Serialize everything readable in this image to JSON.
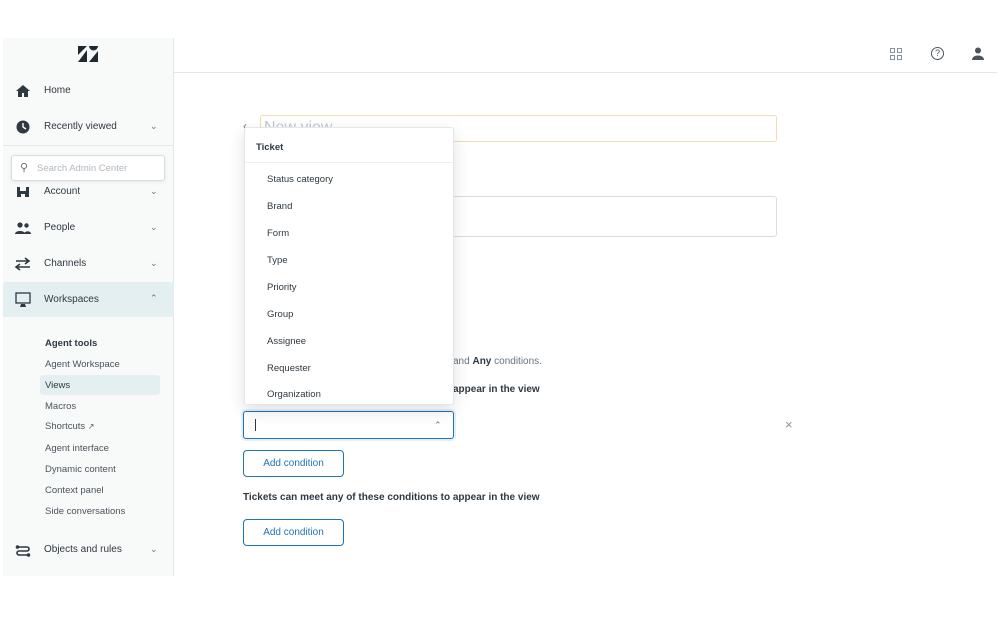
{
  "sidebar": {
    "logo": "Zendesk",
    "home": "Home",
    "recently_viewed": "Recently viewed",
    "search_placeholder": "Search Admin Center",
    "account": "Account",
    "people": "People",
    "channels": "Channels",
    "workspaces": "Workspaces",
    "section_title": "Agent tools",
    "sub_items": [
      "Agent Workspace",
      "Views",
      "Macros",
      "Shortcuts",
      "Agent interface",
      "Dynamic content",
      "Context panel",
      "Side conversations"
    ],
    "active_item": "Views",
    "objects_and_rules": "Objects and rules"
  },
  "header": {
    "icons": [
      "grid-icon",
      "help-icon",
      "user-icon"
    ]
  },
  "main": {
    "title_placeholder": "New view",
    "any_conditions_text_prefix": "and ",
    "any_bold": "Any",
    "any_conditions_text_suffix": " conditions.",
    "all_heading_partial": "appear in the view",
    "add_condition": "Add condition",
    "any_heading": "Tickets can meet any of these conditions to appear in the view"
  },
  "dropdown": {
    "group": "Ticket",
    "items": [
      "Status category",
      "Brand",
      "Form",
      "Type",
      "Priority",
      "Group",
      "Assignee",
      "Requester",
      "Organization"
    ]
  },
  "colors": {
    "accent": "#1f73b7",
    "active_bg": "#e3eff0",
    "title_border": "#f0dfa8"
  }
}
